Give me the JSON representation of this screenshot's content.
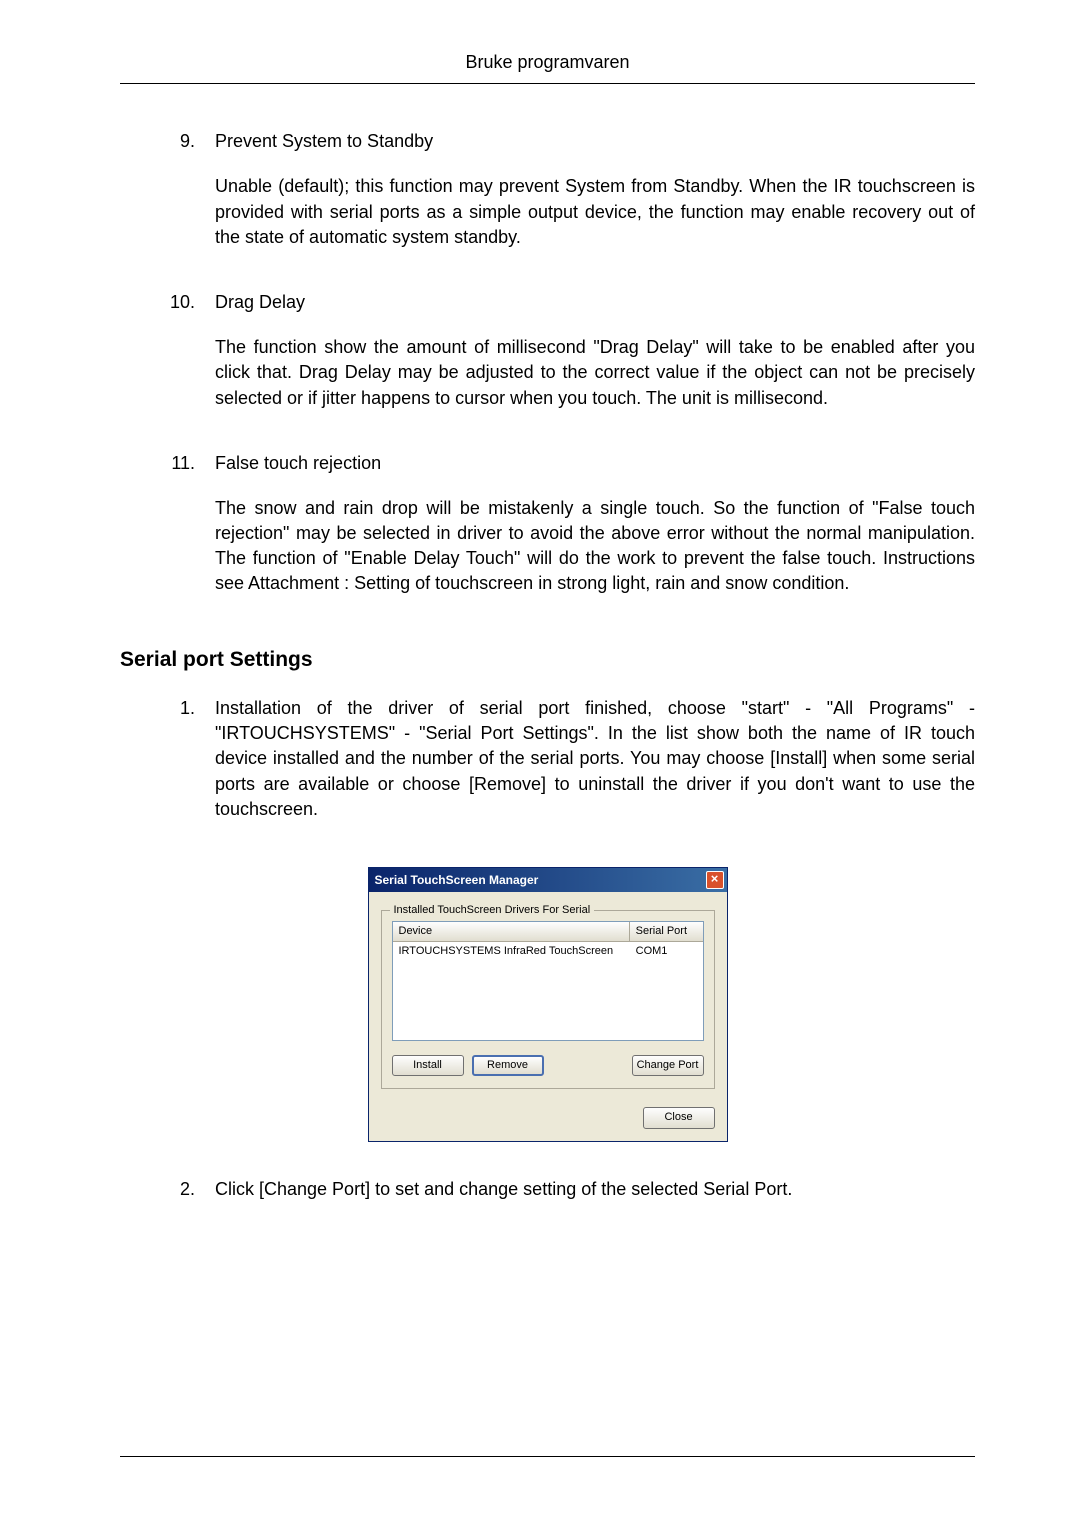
{
  "header": {
    "title": "Bruke programvaren"
  },
  "items": [
    {
      "num": "9.",
      "heading": "Prevent System to Standby",
      "para": "Unable (default); this function may prevent System from Standby. When the IR touchscreen is provided with serial ports as a simple output device, the function may enable recovery out of the state of automatic system standby."
    },
    {
      "num": "10.",
      "heading": "Drag Delay",
      "para": "The function show the amount of millisecond \"Drag Delay\" will take to be enabled after you click that. Drag Delay may be adjusted to the correct value if the object can not be precisely selected or if jitter happens to cursor when you touch. The unit is millisecond."
    },
    {
      "num": "11.",
      "heading": "False touch rejection",
      "para": "The snow and rain drop will be mistakenly a single touch. So the function of \"False touch rejection\" may be selected in driver to avoid the above error without the normal manipulation. The function of \"Enable Delay Touch\" will do the work to prevent the false touch. Instructions see Attachment : Setting of touchscreen in strong light, rain and snow condition."
    }
  ],
  "section2": {
    "heading": "Serial port Settings",
    "items": [
      {
        "num": "1.",
        "para": "Installation of the driver of serial port finished, choose \"start\" - \"All Programs\" - \"IRTOUCHSYSTEMS\" - \"Serial Port Settings\". In the list show both the name of IR touch device installed and the number of the serial ports. You may choose [Install] when some serial ports are available or choose [Remove] to uninstall the driver if you don't want to use the touchscreen."
      },
      {
        "num": "2.",
        "para": "Click [Change Port] to set and change setting of the selected Serial Port."
      }
    ]
  },
  "dialog": {
    "title": "Serial TouchScreen Manager",
    "group_label": "Installed TouchScreen Drivers For Serial",
    "col_device": "Device",
    "col_port": "Serial Port",
    "row_device": "IRTOUCHSYSTEMS InfraRed TouchScreen",
    "row_port": "COM1",
    "btn_install": "Install",
    "btn_remove": "Remove",
    "btn_change": "Change Port",
    "btn_close": "Close"
  }
}
